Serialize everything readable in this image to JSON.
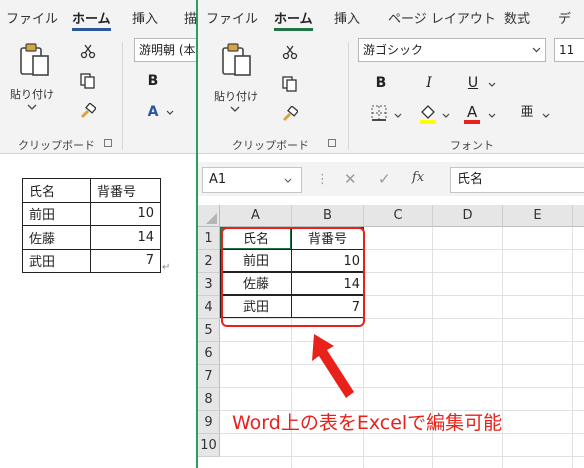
{
  "word": {
    "menu": [
      "ファイル",
      "ホーム",
      "挿入",
      "描"
    ],
    "active_tab": "ホーム",
    "paste_label": "貼り付け",
    "clipboard_group": "クリップボード",
    "font_name": "游明朝 (本",
    "table": {
      "headers": [
        "氏名",
        "背番号"
      ],
      "rows": [
        [
          "前田",
          "10"
        ],
        [
          "佐藤",
          "14"
        ],
        [
          "武田",
          "7"
        ]
      ]
    }
  },
  "excel": {
    "menu": [
      "ファイル",
      "ホーム",
      "挿入",
      "ページ レイアウト",
      "数式",
      "デ"
    ],
    "active_tab": "ホーム",
    "paste_label": "貼り付け",
    "clipboard_group": "クリップボード",
    "font_group": "フォント",
    "font_name": "游ゴシック",
    "font_size": "11",
    "name_box": "A1",
    "formula_value": "氏名",
    "fx_label": "fx",
    "columns": [
      "A",
      "B",
      "C",
      "D",
      "E"
    ],
    "row_numbers": [
      "1",
      "2",
      "3",
      "4",
      "5",
      "6",
      "7",
      "8",
      "9",
      "10"
    ],
    "table": {
      "headers": [
        "氏名",
        "背番号"
      ],
      "rows": [
        [
          "前田",
          "10"
        ],
        [
          "佐藤",
          "14"
        ],
        [
          "武田",
          "7"
        ]
      ]
    },
    "annotation": "Word上の表をExcelで編集可能"
  },
  "colors": {
    "word_accent": "#2b579a",
    "excel_accent": "#217346",
    "annotation": "#e8221b",
    "excel_border": "#2e9e60"
  }
}
